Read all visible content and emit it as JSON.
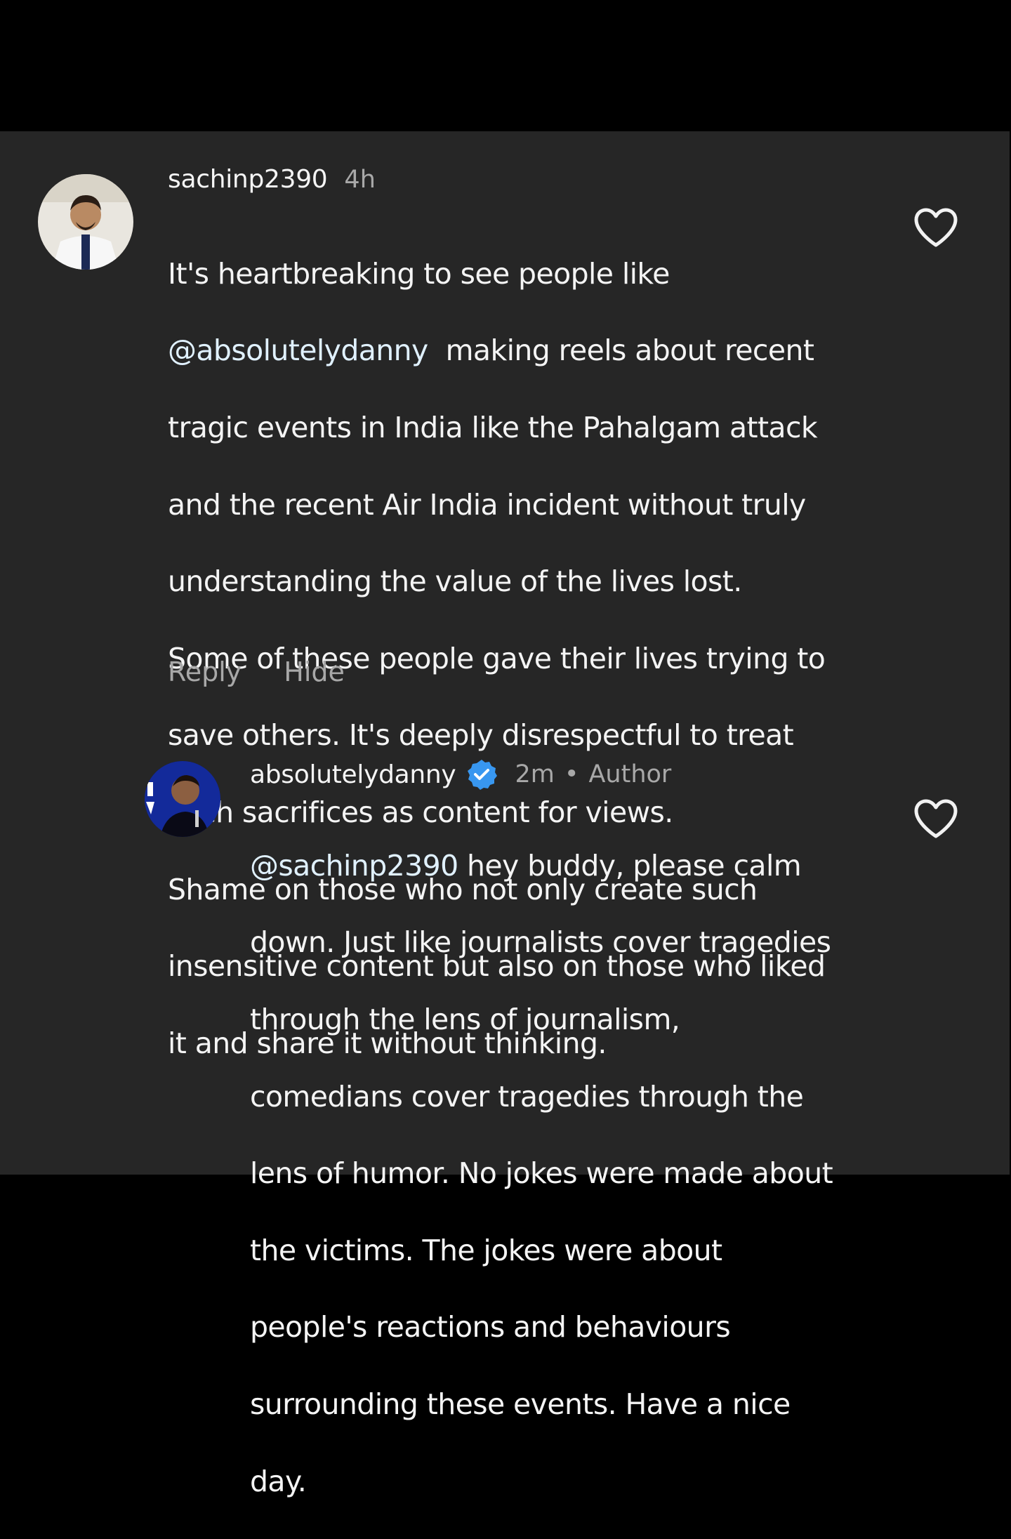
{
  "comments": [
    {
      "username": "sachinp2390",
      "time": "4h",
      "text_lines": [
        "It's heartbreaking to see people like",
        "@absolutelydanny  making reels about recent",
        "tragic events in India like the Pahalgam attack",
        "and the recent Air India incident without truly",
        "understanding the value of the lives lost.",
        "Some of these people gave their lives trying to",
        "save others. It's deeply disrespectful to treat",
        "such sacrifices as content for views.",
        "Shame on those who not only create such",
        "insensitive content but also on those who liked",
        "it and share it without thinking."
      ],
      "mention": "@absolutelydanny",
      "mention_rest": "  making reels about recent",
      "reply_label": "Reply",
      "hide_label": "Hide"
    },
    {
      "username": "absolutelydanny",
      "verified": true,
      "time": "2m",
      "separator": "•",
      "author_label": "Author",
      "mention": "@sachinp2390",
      "first_line_rest": " hey buddy, please calm",
      "text_lines": [
        "down. Just like journalists cover tragedies",
        "through the lens of journalism,",
        "comedians cover tragedies through the",
        "lens of humor. No jokes were made about",
        "the victims. The jokes were about",
        "people's reactions and behaviours",
        "surrounding these events. Have a nice",
        "day."
      ]
    }
  ],
  "colors": {
    "panel_bg": "#262626",
    "outer_bg": "#000000",
    "verified_blue": "#3897f0",
    "muted_text": "#a8a8a8"
  },
  "icons": [
    "heart-icon",
    "verified-badge-icon",
    "avatar"
  ]
}
